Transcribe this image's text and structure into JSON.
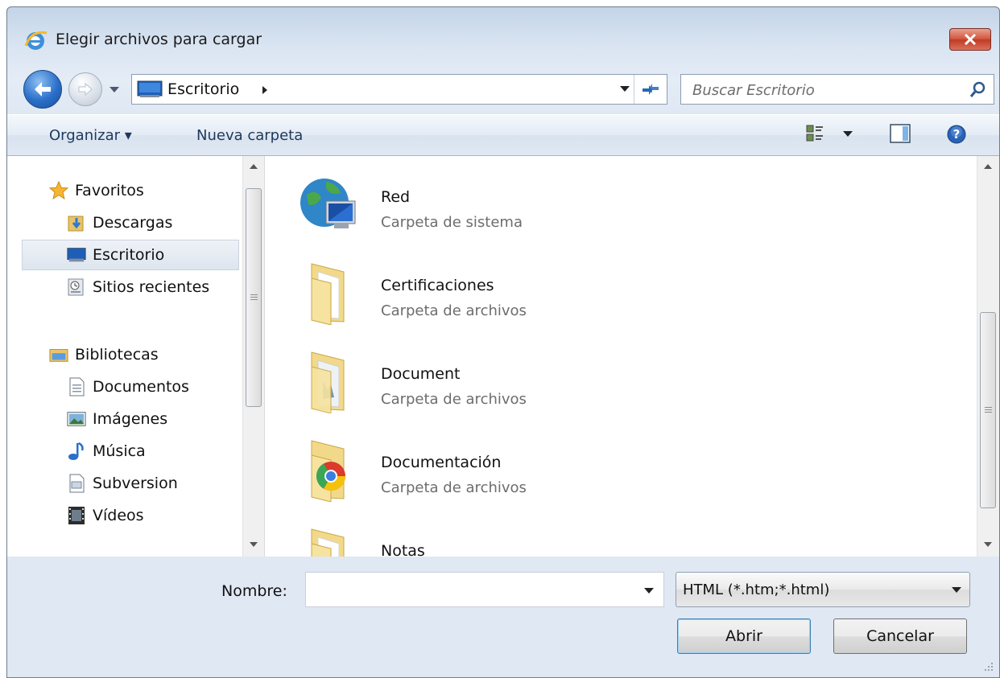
{
  "window": {
    "title": "Elegir archivos para cargar"
  },
  "navigation": {
    "address": "Escritorio",
    "search_placeholder": "Buscar Escritorio"
  },
  "toolbar": {
    "organize_label": "Organizar ▾",
    "new_folder_label": "Nueva carpeta"
  },
  "sidebar": {
    "items": [
      {
        "label": "Favoritos",
        "icon": "star-icon"
      },
      {
        "label": "Descargas",
        "icon": "downloads-folder-icon"
      },
      {
        "label": "Escritorio",
        "icon": "desktop-icon",
        "selected": true
      },
      {
        "label": "Sitios recientes",
        "icon": "recent-places-icon"
      },
      {
        "label": "Bibliotecas",
        "icon": "libraries-icon"
      },
      {
        "label": "Documentos",
        "icon": "documents-icon"
      },
      {
        "label": "Imágenes",
        "icon": "pictures-icon"
      },
      {
        "label": "Música",
        "icon": "music-icon"
      },
      {
        "label": "Subversion",
        "icon": "subversion-icon"
      },
      {
        "label": "Vídeos",
        "icon": "videos-icon"
      }
    ]
  },
  "files": [
    {
      "name": "Red",
      "type": "Carpeta de sistema",
      "icon": "network-icon"
    },
    {
      "name": "Certificaciones",
      "type": "Carpeta de archivos",
      "icon": "folder-icon"
    },
    {
      "name": "Document",
      "type": "Carpeta de archivos",
      "icon": "folder-images-icon"
    },
    {
      "name": "Documentación",
      "type": "Carpeta de archivos",
      "icon": "folder-chrome-icon"
    },
    {
      "name": "Notas",
      "type": "",
      "icon": "folder-icon"
    }
  ],
  "footer": {
    "name_label": "Nombre:",
    "name_value": "",
    "filter_value": "HTML (*.htm;*.html)",
    "open_label": "Abrir",
    "cancel_label": "Cancelar"
  },
  "colors": {
    "titlebar": "#c3d4e7",
    "close_button": "#c03a22",
    "selection": "#dde5ee",
    "link_text": "#1e395b"
  }
}
